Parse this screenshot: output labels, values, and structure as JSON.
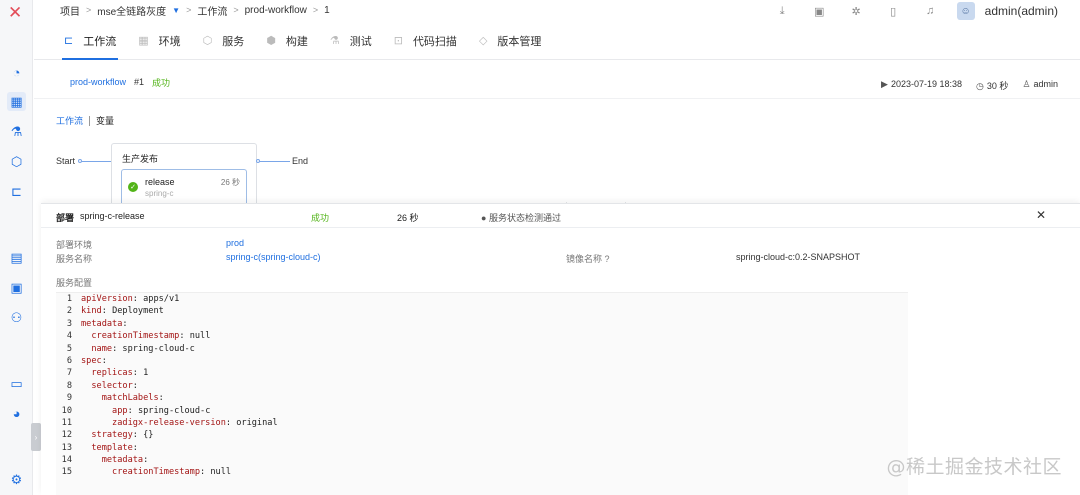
{
  "breadcrumb": {
    "items": [
      "项目",
      "mse全链路灰度",
      "工作流",
      "prod-workflow",
      "1"
    ]
  },
  "user": {
    "name": "admin(admin)"
  },
  "topbar_icons": [
    "download-icon",
    "translate-icon",
    "plugin-icon",
    "docs-icon",
    "bell-icon"
  ],
  "tabs": [
    {
      "label": "工作流",
      "icon": "workflow-icon",
      "active": true
    },
    {
      "label": "环境",
      "icon": "env-icon",
      "active": false
    },
    {
      "label": "服务",
      "icon": "service-icon",
      "active": false
    },
    {
      "label": "构建",
      "icon": "build-icon",
      "active": false
    },
    {
      "label": "测试",
      "icon": "test-icon",
      "active": false
    },
    {
      "label": "代码扫描",
      "icon": "scan-icon",
      "active": false
    },
    {
      "label": "版本管理",
      "icon": "version-icon",
      "active": false
    }
  ],
  "workflow": {
    "name": "prod-workflow",
    "run": "#1",
    "status": "成功",
    "start_time": "2023-07-19 18:38",
    "duration": "30 秒",
    "creator": "admin"
  },
  "subtabs": {
    "workflow": "工作流",
    "vars": "变量"
  },
  "pipeline": {
    "start": "Start",
    "end": "End",
    "stage": {
      "title": "生产发布",
      "job": {
        "name": "release",
        "service": "spring-c",
        "time": "26 秒"
      }
    }
  },
  "deploy": {
    "tag": "部署",
    "service": "spring-c-release",
    "status": "成功",
    "time": "26 秒",
    "check": "服务状态检测通过",
    "env_label": "部署环境",
    "env_value": "prod",
    "svc_label": "服务名称",
    "svc_value": "spring-c(spring-cloud-c)",
    "image_label": "镜像名称",
    "image_value": "spring-cloud-c:0.2-SNAPSHOT",
    "config_label": "服务配置",
    "code": [
      {
        "n": "1",
        "indent": "",
        "key": "apiVersion",
        "val": "apps/v1"
      },
      {
        "n": "2",
        "indent": "",
        "key": "kind",
        "val": "Deployment"
      },
      {
        "n": "3",
        "indent": "",
        "key": "metadata",
        "val": ""
      },
      {
        "n": "4",
        "indent": "  ",
        "key": "creationTimestamp",
        "val": "null"
      },
      {
        "n": "5",
        "indent": "  ",
        "key": "name",
        "val": "spring-cloud-c"
      },
      {
        "n": "6",
        "indent": "",
        "key": "spec",
        "val": ""
      },
      {
        "n": "7",
        "indent": "  ",
        "key": "replicas",
        "val": "1"
      },
      {
        "n": "8",
        "indent": "  ",
        "key": "selector",
        "val": ""
      },
      {
        "n": "9",
        "indent": "    ",
        "key": "matchLabels",
        "val": ""
      },
      {
        "n": "10",
        "indent": "      ",
        "key": "app",
        "val": "spring-cloud-c"
      },
      {
        "n": "11",
        "indent": "      ",
        "key": "zadigx-release-version",
        "val": "original"
      },
      {
        "n": "12",
        "indent": "  ",
        "key": "strategy",
        "val": "{}"
      },
      {
        "n": "13",
        "indent": "  ",
        "key": "template",
        "val": ""
      },
      {
        "n": "14",
        "indent": "    ",
        "key": "metadata",
        "val": ""
      },
      {
        "n": "15",
        "indent": "      ",
        "key": "creationTimestamp",
        "val": "null"
      }
    ]
  },
  "watermark": "@稀土掘金技术社区"
}
